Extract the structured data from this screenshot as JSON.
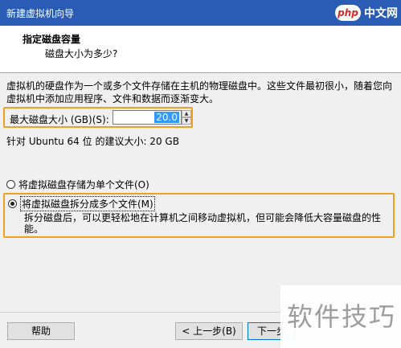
{
  "window": {
    "title": "新建虚拟机向导"
  },
  "watermark_top": {
    "logo": "php",
    "text": "中文网"
  },
  "header": {
    "title": "指定磁盘容量",
    "subtitle": "磁盘大小为多少?"
  },
  "description": "虚拟机的硬盘作为一个或多个文件存储在主机的物理磁盘中。这些文件最初很小，随着您向虚拟机中添加应用程序、文件和数据而逐渐变大。",
  "disk_size": {
    "label": "最大磁盘大小 (GB)(S):",
    "value": "20.0"
  },
  "recommended": "针对 Ubuntu 64 位 的建议大小: 20 GB",
  "options": {
    "single_file": {
      "label": "将虚拟磁盘存储为单个文件(O)",
      "checked": false
    },
    "split_files": {
      "label": "将虚拟磁盘拆分成多个文件(M)",
      "checked": true,
      "description": "拆分磁盘后，可以更轻松地在计算机之间移动虚拟机，但可能会降低大容量磁盘的性能。"
    }
  },
  "buttons": {
    "help": "帮助",
    "back": "< 上一步(B)",
    "next": "下一步"
  },
  "watermark_br": "软件技巧"
}
